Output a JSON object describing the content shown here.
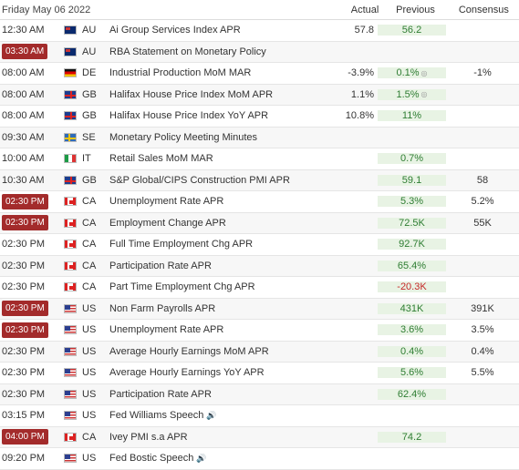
{
  "header": {
    "date": "Friday May 06 2022",
    "actual": "Actual",
    "previous": "Previous",
    "consensus": "Consensus"
  },
  "rows": [
    {
      "time": "12:30 AM",
      "hi": false,
      "country": "AU",
      "flag": "au",
      "event": "Ai Group Services Index APR",
      "actual": "57.8",
      "actual_color": "",
      "previous": "56.2",
      "prev_color": "pos",
      "consensus": ""
    },
    {
      "time": "03:30 AM",
      "hi": true,
      "country": "AU",
      "flag": "au",
      "event": "RBA Statement on Monetary Policy",
      "actual": "",
      "actual_color": "",
      "previous": "",
      "prev_color": "",
      "consensus": ""
    },
    {
      "time": "08:00 AM",
      "hi": false,
      "country": "DE",
      "flag": "de",
      "event": "Industrial Production MoM MAR",
      "actual": "-3.9%",
      "actual_color": "",
      "previous": "0.1%",
      "prev_color": "pos",
      "prev_info": true,
      "consensus": "-1%"
    },
    {
      "time": "08:00 AM",
      "hi": false,
      "country": "GB",
      "flag": "gb",
      "event": "Halifax House Price Index MoM APR",
      "actual": "1.1%",
      "actual_color": "",
      "previous": "1.5%",
      "prev_color": "pos",
      "prev_info": true,
      "consensus": ""
    },
    {
      "time": "08:00 AM",
      "hi": false,
      "country": "GB",
      "flag": "gb",
      "event": "Halifax House Price Index YoY APR",
      "actual": "10.8%",
      "actual_color": "",
      "previous": "11%",
      "prev_color": "pos",
      "consensus": ""
    },
    {
      "time": "09:30 AM",
      "hi": false,
      "country": "SE",
      "flag": "se",
      "event": "Monetary Policy Meeting Minutes",
      "actual": "",
      "actual_color": "",
      "previous": "",
      "prev_color": "",
      "consensus": ""
    },
    {
      "time": "10:00 AM",
      "hi": false,
      "country": "IT",
      "flag": "it",
      "event": "Retail Sales MoM MAR",
      "actual": "",
      "actual_color": "",
      "previous": "0.7%",
      "prev_color": "pos",
      "consensus": ""
    },
    {
      "time": "10:30 AM",
      "hi": false,
      "country": "GB",
      "flag": "gb",
      "event": "S&P Global/CIPS Construction PMI APR",
      "actual": "",
      "actual_color": "",
      "previous": "59.1",
      "prev_color": "pos",
      "consensus": "58"
    },
    {
      "time": "02:30 PM",
      "hi": true,
      "country": "CA",
      "flag": "ca",
      "event": "Unemployment Rate APR",
      "actual": "",
      "actual_color": "",
      "previous": "5.3%",
      "prev_color": "pos",
      "consensus": "5.2%"
    },
    {
      "time": "02:30 PM",
      "hi": true,
      "country": "CA",
      "flag": "ca",
      "event": "Employment Change APR",
      "actual": "",
      "actual_color": "",
      "previous": "72.5K",
      "prev_color": "pos",
      "consensus": "55K"
    },
    {
      "time": "02:30 PM",
      "hi": false,
      "country": "CA",
      "flag": "ca",
      "event": "Full Time Employment Chg APR",
      "actual": "",
      "actual_color": "",
      "previous": "92.7K",
      "prev_color": "pos",
      "consensus": ""
    },
    {
      "time": "02:30 PM",
      "hi": false,
      "country": "CA",
      "flag": "ca",
      "event": "Participation Rate APR",
      "actual": "",
      "actual_color": "",
      "previous": "65.4%",
      "prev_color": "pos",
      "consensus": ""
    },
    {
      "time": "02:30 PM",
      "hi": false,
      "country": "CA",
      "flag": "ca",
      "event": "Part Time Employment Chg APR",
      "actual": "",
      "actual_color": "",
      "previous": "-20.3K",
      "prev_color": "neg",
      "consensus": ""
    },
    {
      "time": "02:30 PM",
      "hi": true,
      "country": "US",
      "flag": "us",
      "event": "Non Farm Payrolls APR",
      "actual": "",
      "actual_color": "",
      "previous": "431K",
      "prev_color": "pos",
      "consensus": "391K"
    },
    {
      "time": "02:30 PM",
      "hi": true,
      "country": "US",
      "flag": "us",
      "event": "Unemployment Rate APR",
      "actual": "",
      "actual_color": "",
      "previous": "3.6%",
      "prev_color": "pos",
      "consensus": "3.5%"
    },
    {
      "time": "02:30 PM",
      "hi": false,
      "country": "US",
      "flag": "us",
      "event": "Average Hourly Earnings MoM APR",
      "actual": "",
      "actual_color": "",
      "previous": "0.4%",
      "prev_color": "pos",
      "consensus": "0.4%"
    },
    {
      "time": "02:30 PM",
      "hi": false,
      "country": "US",
      "flag": "us",
      "event": "Average Hourly Earnings YoY APR",
      "actual": "",
      "actual_color": "",
      "previous": "5.6%",
      "prev_color": "pos",
      "consensus": "5.5%"
    },
    {
      "time": "02:30 PM",
      "hi": false,
      "country": "US",
      "flag": "us",
      "event": "Participation Rate APR",
      "actual": "",
      "actual_color": "",
      "previous": "62.4%",
      "prev_color": "pos",
      "consensus": ""
    },
    {
      "time": "03:15 PM",
      "hi": false,
      "country": "US",
      "flag": "us",
      "event": "Fed Williams Speech",
      "speech": true,
      "actual": "",
      "actual_color": "",
      "previous": "",
      "prev_color": "",
      "consensus": ""
    },
    {
      "time": "04:00 PM",
      "hi": true,
      "country": "CA",
      "flag": "ca",
      "event": "Ivey PMI s.a APR",
      "actual": "",
      "actual_color": "",
      "previous": "74.2",
      "prev_color": "pos",
      "consensus": ""
    },
    {
      "time": "09:20 PM",
      "hi": false,
      "country": "US",
      "flag": "us",
      "event": "Fed Bostic Speech",
      "speech": true,
      "actual": "",
      "actual_color": "",
      "previous": "",
      "prev_color": "",
      "consensus": ""
    }
  ],
  "icons": {
    "speaker": "speaker-icon",
    "info": "info-icon"
  },
  "colors": {
    "high_impact": "#a32b2b",
    "positive": "#2e7d32",
    "negative": "#c62828",
    "previous_bg": "#e8f3e4"
  }
}
